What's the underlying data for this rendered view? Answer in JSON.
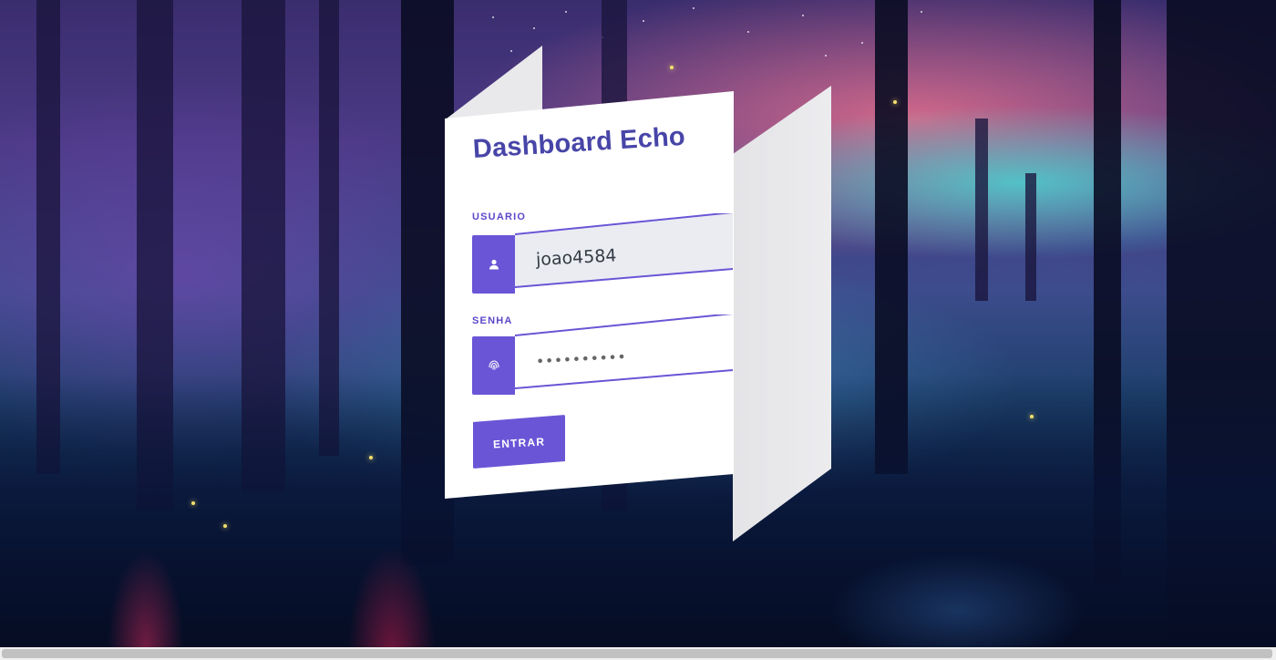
{
  "login": {
    "title": "Dashboard Echo",
    "username_label": "USUARIO",
    "username_value": "joao4584",
    "password_label": "SENHA",
    "password_value": "••••••••••",
    "submit_label": "ENTRAR"
  },
  "icons": {
    "username": "user-icon",
    "password": "fingerprint-icon"
  },
  "colors": {
    "accent": "#6a55d6",
    "title": "#4845a8",
    "field_fill": "#eaecf2"
  }
}
